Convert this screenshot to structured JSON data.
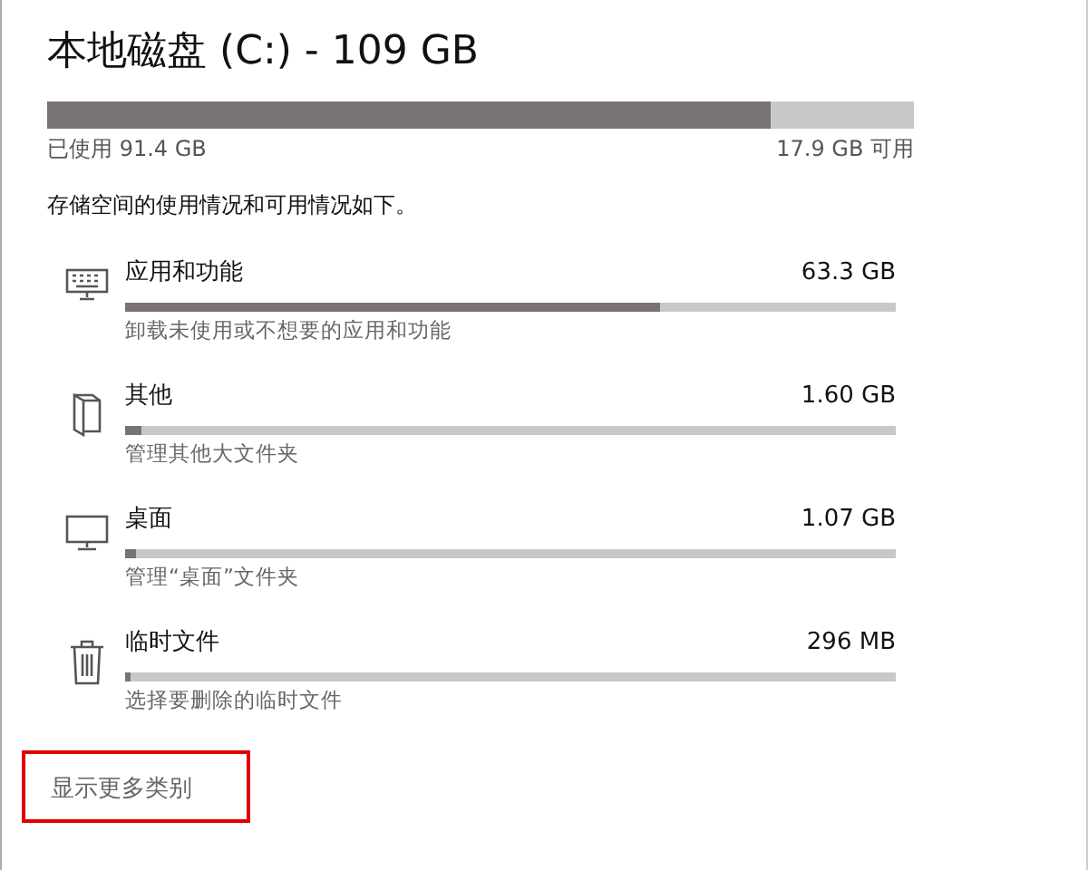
{
  "title": "本地磁盘 (C:) - 109 GB",
  "usage": {
    "level": 0.834,
    "used": "已使用 91.4 GB",
    "free": "17.9 GB 可用"
  },
  "description": "存储空间的使用情况和可用情况如下。",
  "categories": [
    {
      "kind": "apps",
      "name": "应用和功能",
      "size": "63.3 GB",
      "level": 0.694,
      "hint": "卸载未使用或不想要的应用和功能"
    },
    {
      "kind": "other",
      "name": "其他",
      "size": "1.60 GB",
      "level": 0.02,
      "hint": "管理其他大文件夹"
    },
    {
      "kind": "desktop",
      "name": "桌面",
      "size": "1.07 GB",
      "level": 0.013,
      "hint": "管理“桌面”文件夹"
    },
    {
      "kind": "temp",
      "name": "临时文件",
      "size": "296 MB",
      "level": 0.004,
      "hint": "选择要删除的临时文件"
    }
  ],
  "more_link": {
    "label": "显示更多类别",
    "highlighted": true
  }
}
